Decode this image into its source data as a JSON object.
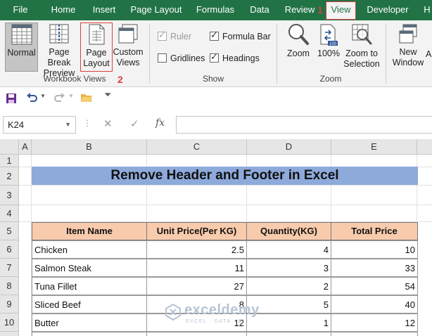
{
  "ribbon_tabs": [
    {
      "label": "File"
    },
    {
      "label": "Home"
    },
    {
      "label": "Insert"
    },
    {
      "label": "Page Layout"
    },
    {
      "label": "Formulas"
    },
    {
      "label": "Data"
    },
    {
      "label": "Review"
    },
    {
      "label": "View"
    },
    {
      "label": "Developer"
    },
    {
      "label": "H"
    }
  ],
  "annotations": {
    "step1": "1",
    "step2": "2"
  },
  "workbook_views": {
    "normal": "Normal",
    "page_break_preview_line1": "Page Break",
    "page_break_preview_line2": "Preview",
    "page_layout_line1": "Page",
    "page_layout_line2": "Layout",
    "custom_views_line1": "Custom",
    "custom_views_line2": "Views",
    "group_label": "Workbook Views"
  },
  "show": {
    "ruler": "Ruler",
    "gridlines": "Gridlines",
    "formula_bar": "Formula Bar",
    "headings": "Headings",
    "group_label": "Show",
    "ruler_checked": true,
    "gridlines_checked": false,
    "formula_bar_checked": true,
    "headings_checked": true
  },
  "zoom": {
    "zoom": "Zoom",
    "hundred": "100%",
    "zoom_to_selection_line1": "Zoom to",
    "zoom_to_selection_line2": "Selection",
    "group_label": "Zoom"
  },
  "window": {
    "new_window_line1": "New",
    "new_window_line2": "Window",
    "cut_off": "A"
  },
  "formula_bar": {
    "name_box": "K24",
    "fx": "fx",
    "formula": ""
  },
  "columns": [
    "A",
    "B",
    "C",
    "D",
    "E"
  ],
  "rows": [
    "1",
    "2",
    "3",
    "4",
    "5",
    "6",
    "7",
    "8",
    "9",
    "10"
  ],
  "sheet": {
    "title": "Remove Header and Footer in Excel",
    "headers": [
      "Item Name",
      "Unit Price(Per KG)",
      "Quantity(KG)",
      "Total Price"
    ],
    "rows": [
      [
        "Chicken",
        "2.5",
        "4",
        "10"
      ],
      [
        "Salmon Steak",
        "11",
        "3",
        "33"
      ],
      [
        "Tuna Fillet",
        "27",
        "2",
        "54"
      ],
      [
        "Sliced Beef",
        "8",
        "5",
        "40"
      ],
      [
        "Butter",
        "12",
        "1",
        "12"
      ]
    ]
  },
  "watermark": {
    "name": "exceldemy",
    "tagline": "EXCEL · DATA · BI"
  },
  "colors": {
    "ribbon_green": "#217346",
    "title_band": "#8eaadb",
    "table_header": "#f8cbad",
    "annotation_red": "#d8413a"
  }
}
